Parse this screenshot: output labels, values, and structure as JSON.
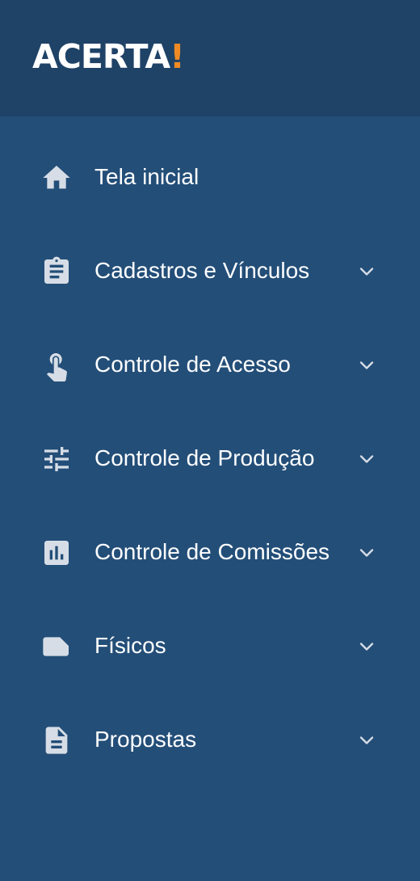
{
  "brand": {
    "logo_text": "ACERTA",
    "logo_accent": "!",
    "accent_color": "#f08a24"
  },
  "theme": {
    "sidebar_bg": "#234e78",
    "brand_bar_bg": "#1f4267",
    "icon_color": "#d7dde6",
    "text_color": "#ffffff"
  },
  "menu": {
    "items": [
      {
        "label": "Tela inicial",
        "icon": "home-icon",
        "expandable": false
      },
      {
        "label": "Cadastros e Vínculos",
        "icon": "clipboard-icon",
        "expandable": true
      },
      {
        "label": "Controle de Acesso",
        "icon": "touch-icon",
        "expandable": true
      },
      {
        "label": "Controle de Produção",
        "icon": "tune-icon",
        "expandable": true
      },
      {
        "label": "Controle de Comissões",
        "icon": "bar-chart-icon",
        "expandable": true
      },
      {
        "label": "Físicos",
        "icon": "label-icon",
        "expandable": true
      },
      {
        "label": "Propostas",
        "icon": "document-icon",
        "expandable": true
      }
    ]
  }
}
